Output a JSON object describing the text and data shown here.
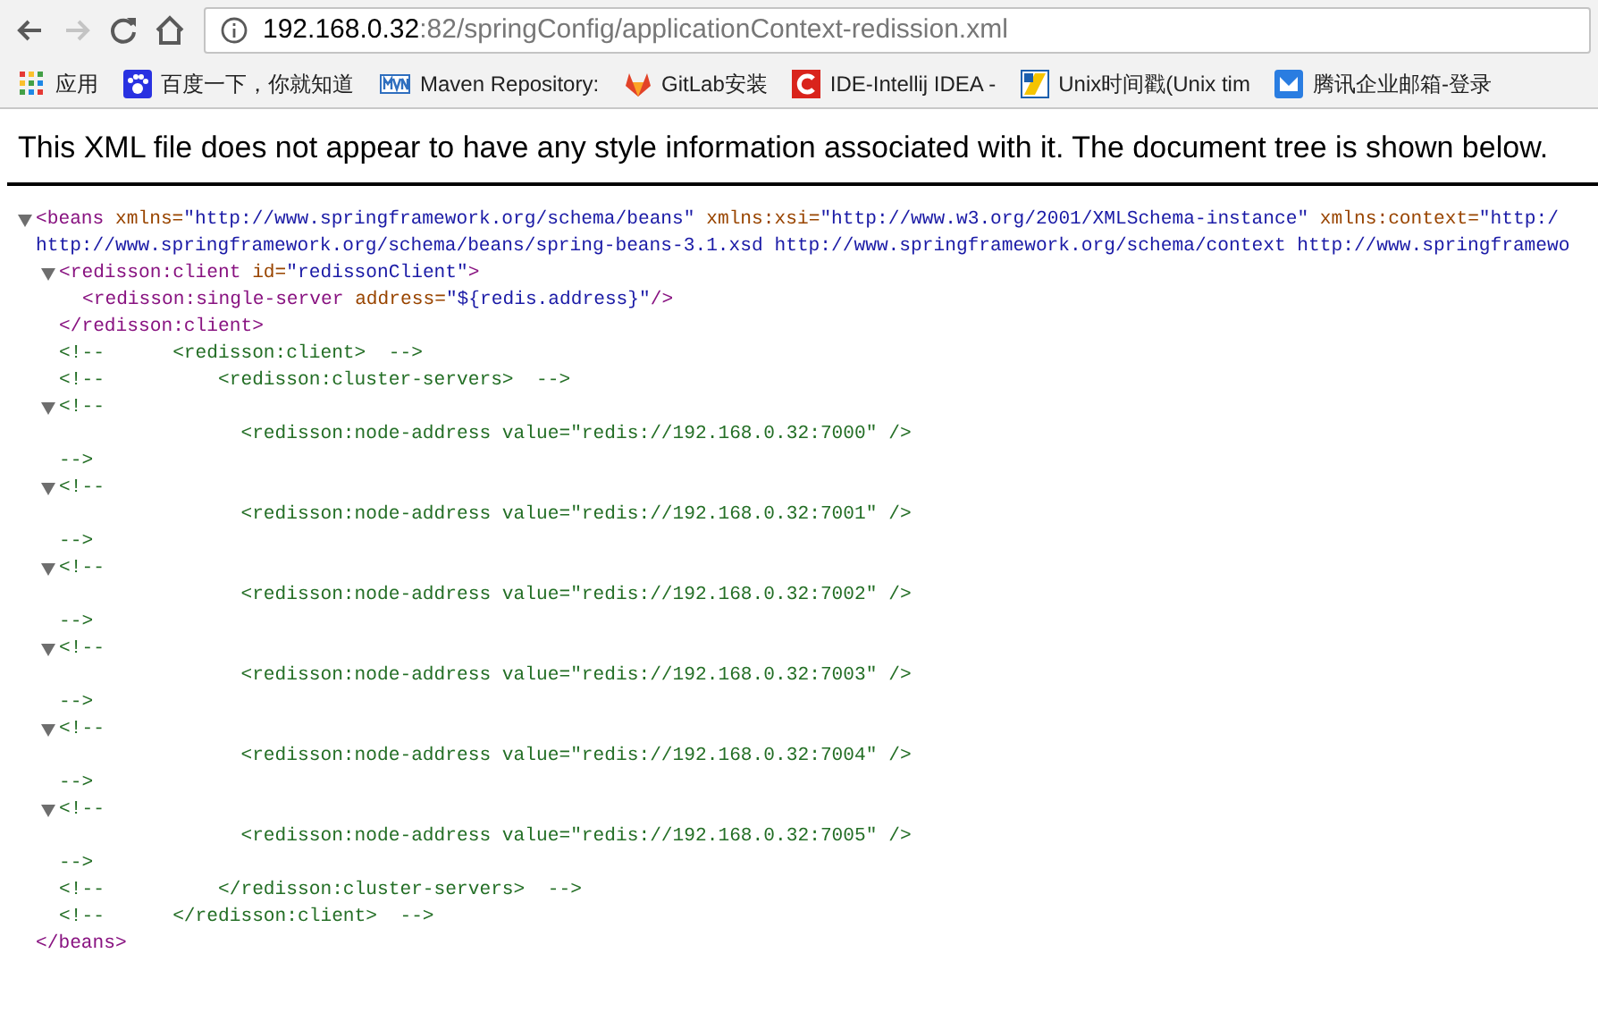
{
  "browser": {
    "nav_buttons": [
      {
        "kind": "back",
        "disabled": false
      },
      {
        "kind": "forward",
        "disabled": true
      },
      {
        "kind": "reload",
        "disabled": false
      },
      {
        "kind": "home",
        "disabled": false
      }
    ],
    "address": {
      "host": "192.168.0.32",
      "rest": ":82/springConfig/applicationContext-redission.xml"
    },
    "bookmarks": [
      {
        "kind": "apps",
        "label": "应用"
      },
      {
        "kind": "paw",
        "label": "百度一下，你就知道"
      },
      {
        "kind": "mvn",
        "label": "Maven Repository:"
      },
      {
        "kind": "gitlab",
        "label": "GitLab安装"
      },
      {
        "kind": "c-logo",
        "label": "IDE-Intellij IDEA -"
      },
      {
        "kind": "unix",
        "label": "Unix时间戳(Unix tim"
      },
      {
        "kind": "mail",
        "label": "腾讯企业邮箱-登录"
      }
    ]
  },
  "notice": "This XML file does not appear to have any style information associated with it. The document tree is shown below.",
  "xml": [
    {
      "kind": "element",
      "expanded": true,
      "open": [
        [
          {
            "kind": "tag",
            "text": "<beans"
          },
          {
            "kind": "attr",
            "text": " xmlns="
          },
          {
            "kind": "value",
            "text": "\"http://www.springframework.org/schema/beans\""
          },
          {
            "kind": "attr",
            "text": " xmlns:xsi="
          },
          {
            "kind": "value",
            "text": "\"http://www.w3.org/2001/XMLSchema-instance\""
          },
          {
            "kind": "attr",
            "text": " xmlns:context="
          },
          {
            "kind": "value",
            "text": "\"http:/"
          }
        ],
        [
          {
            "kind": "value",
            "text": "http://www.springframework.org/schema/beans/spring-beans-3.1.xsd http://www.springframework.org/schema/context http://www.springframewo"
          }
        ]
      ],
      "children": [
        {
          "kind": "element",
          "expanded": true,
          "open": [
            [
              {
                "kind": "tag",
                "text": "<redisson:client"
              },
              {
                "kind": "attr",
                "text": " id="
              },
              {
                "kind": "value",
                "text": "\"redissonClient\""
              },
              {
                "kind": "tag",
                "text": ">"
              }
            ]
          ],
          "children": [
            {
              "kind": "leaf",
              "open": [
                [
                  {
                    "kind": "tag",
                    "text": "<redisson:single-server"
                  },
                  {
                    "kind": "attr",
                    "text": " address="
                  },
                  {
                    "kind": "value",
                    "text": "\"${redis.address}\""
                  },
                  {
                    "kind": "tag",
                    "text": "/>"
                  }
                ]
              ]
            }
          ],
          "close": [
            {
              "kind": "tag",
              "text": "</redisson:client>"
            }
          ]
        },
        {
          "kind": "comment",
          "text": "<!--      <redisson:client>  -->"
        },
        {
          "kind": "comment",
          "text": "<!--          <redisson:cluster-servers>  -->"
        },
        {
          "kind": "comment-block",
          "expanded": true,
          "open": "<!--",
          "body": "                <redisson:node-address value=\"redis://192.168.0.32:7000\" />",
          "close": "-->"
        },
        {
          "kind": "comment-block",
          "expanded": true,
          "open": "<!--",
          "body": "                <redisson:node-address value=\"redis://192.168.0.32:7001\" />",
          "close": "-->"
        },
        {
          "kind": "comment-block",
          "expanded": true,
          "open": "<!--",
          "body": "                <redisson:node-address value=\"redis://192.168.0.32:7002\" />",
          "close": "-->"
        },
        {
          "kind": "comment-block",
          "expanded": true,
          "open": "<!--",
          "body": "                <redisson:node-address value=\"redis://192.168.0.32:7003\" />",
          "close": "-->"
        },
        {
          "kind": "comment-block",
          "expanded": true,
          "open": "<!--",
          "body": "                <redisson:node-address value=\"redis://192.168.0.32:7004\" />",
          "close": "-->"
        },
        {
          "kind": "comment-block",
          "expanded": true,
          "open": "<!--",
          "body": "                <redisson:node-address value=\"redis://192.168.0.32:7005\" />",
          "close": "-->"
        },
        {
          "kind": "comment",
          "text": "<!--          </redisson:cluster-servers>  -->"
        },
        {
          "kind": "comment",
          "text": "<!--      </redisson:client>  -->"
        }
      ],
      "close": [
        {
          "kind": "tag",
          "text": "</beans>"
        }
      ]
    }
  ]
}
